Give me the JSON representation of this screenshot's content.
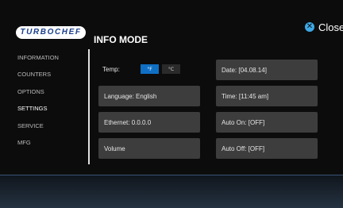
{
  "header": {
    "logo_text": "TURBOCHEF",
    "title": "INFO MODE",
    "close_label": "Close"
  },
  "sidebar": {
    "items": [
      {
        "label": "INFORMATION"
      },
      {
        "label": "COUNTERS"
      },
      {
        "label": "OPTIONS"
      },
      {
        "label": "SETTINGS",
        "active": true
      },
      {
        "label": "SERVICE"
      },
      {
        "label": "MFG"
      }
    ]
  },
  "settings": {
    "temp": {
      "label": "Temp:",
      "fahrenheit": "°F",
      "celsius": "°C",
      "selected": "°F"
    },
    "language": "Language: English",
    "ethernet": "Ethernet: 0.0.0.0",
    "volume": "Volume",
    "date": "Date: [04.08.14]",
    "time": "Time: [11:45 am]",
    "auto_on": "Auto On: [OFF]",
    "auto_off": "Auto Off: [OFF]"
  },
  "colors": {
    "accent": "#0f6fc4",
    "close_icon": "#3ea8e6",
    "button_bg": "#3d3d3d",
    "logo_text": "#1b3f8c",
    "background": "#0c0c0c"
  }
}
